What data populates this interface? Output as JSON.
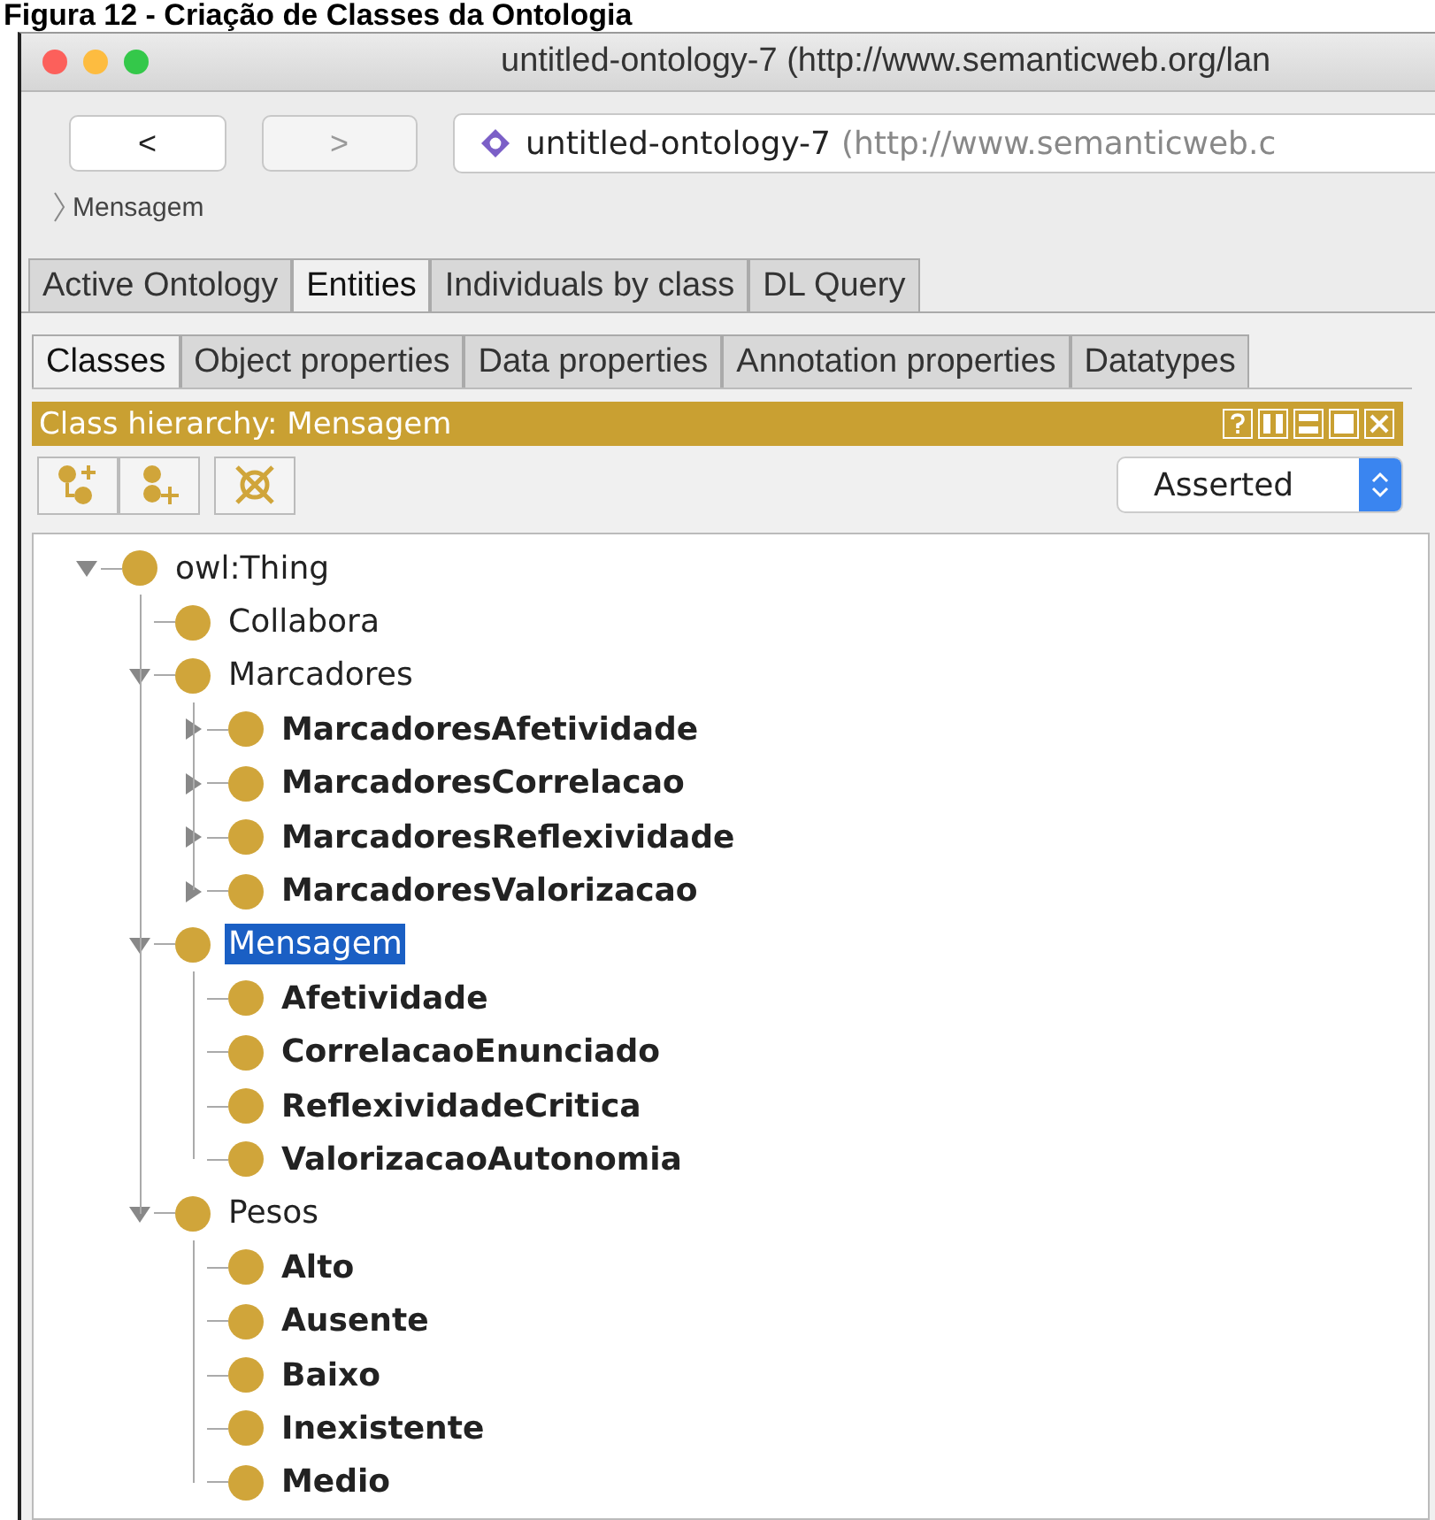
{
  "caption": "Figura 12 - Criação de Classes da Ontologia",
  "window": {
    "title": "untitled-ontology-7 (http://www.semanticweb.org/lan"
  },
  "nav": [
    {
      "label": "<",
      "disabled": false
    },
    {
      "label": ">",
      "disabled": true
    }
  ],
  "address": {
    "name": "untitled-ontology-7",
    "iri": "(http://www.semanticweb.c"
  },
  "breadcrumb": [
    "Mensagem"
  ],
  "tabs": [
    {
      "label": "Active Ontology",
      "selected": false
    },
    {
      "label": "Entities",
      "selected": true
    },
    {
      "label": "Individuals by class",
      "selected": false
    },
    {
      "label": "DL Query",
      "selected": false
    }
  ],
  "subtabs": [
    {
      "label": "Classes",
      "selected": true
    },
    {
      "label": "Object properties",
      "selected": false
    },
    {
      "label": "Data properties",
      "selected": false
    },
    {
      "label": "Annotation properties",
      "selected": false
    },
    {
      "label": "Datatypes",
      "selected": false
    }
  ],
  "panel": {
    "title": "Class hierarchy: Mensagem",
    "mode": "Asserted",
    "tree": [
      {
        "label": "owl:Thing",
        "bold": false,
        "selected": false,
        "expanded": true,
        "children": [
          {
            "label": "Collabora",
            "bold": false,
            "selected": false
          },
          {
            "label": "Marcadores",
            "bold": false,
            "selected": false,
            "expanded": true,
            "children": [
              {
                "label": "MarcadoresAfetividade",
                "bold": true,
                "selected": false,
                "expanded": false
              },
              {
                "label": "MarcadoresCorrelacao",
                "bold": true,
                "selected": false,
                "expanded": false
              },
              {
                "label": "MarcadoresReflexividade",
                "bold": true,
                "selected": false,
                "expanded": false
              },
              {
                "label": "MarcadoresValorizacao",
                "bold": true,
                "selected": false,
                "expanded": false
              }
            ]
          },
          {
            "label": "Mensagem",
            "bold": false,
            "selected": true,
            "expanded": true,
            "children": [
              {
                "label": "Afetividade",
                "bold": true,
                "selected": false
              },
              {
                "label": "CorrelacaoEnunciado",
                "bold": true,
                "selected": false
              },
              {
                "label": "ReflexividadeCritica",
                "bold": true,
                "selected": false
              },
              {
                "label": "ValorizacaoAutonomia",
                "bold": true,
                "selected": false
              }
            ]
          },
          {
            "label": "Pesos",
            "bold": false,
            "selected": false,
            "expanded": true,
            "children": [
              {
                "label": "Alto",
                "bold": true,
                "selected": false
              },
              {
                "label": "Ausente",
                "bold": true,
                "selected": false
              },
              {
                "label": "Baixo",
                "bold": true,
                "selected": false
              },
              {
                "label": "Inexistente",
                "bold": true,
                "selected": false
              },
              {
                "label": "Medio",
                "bold": true,
                "selected": false
              }
            ]
          }
        ]
      }
    ]
  }
}
